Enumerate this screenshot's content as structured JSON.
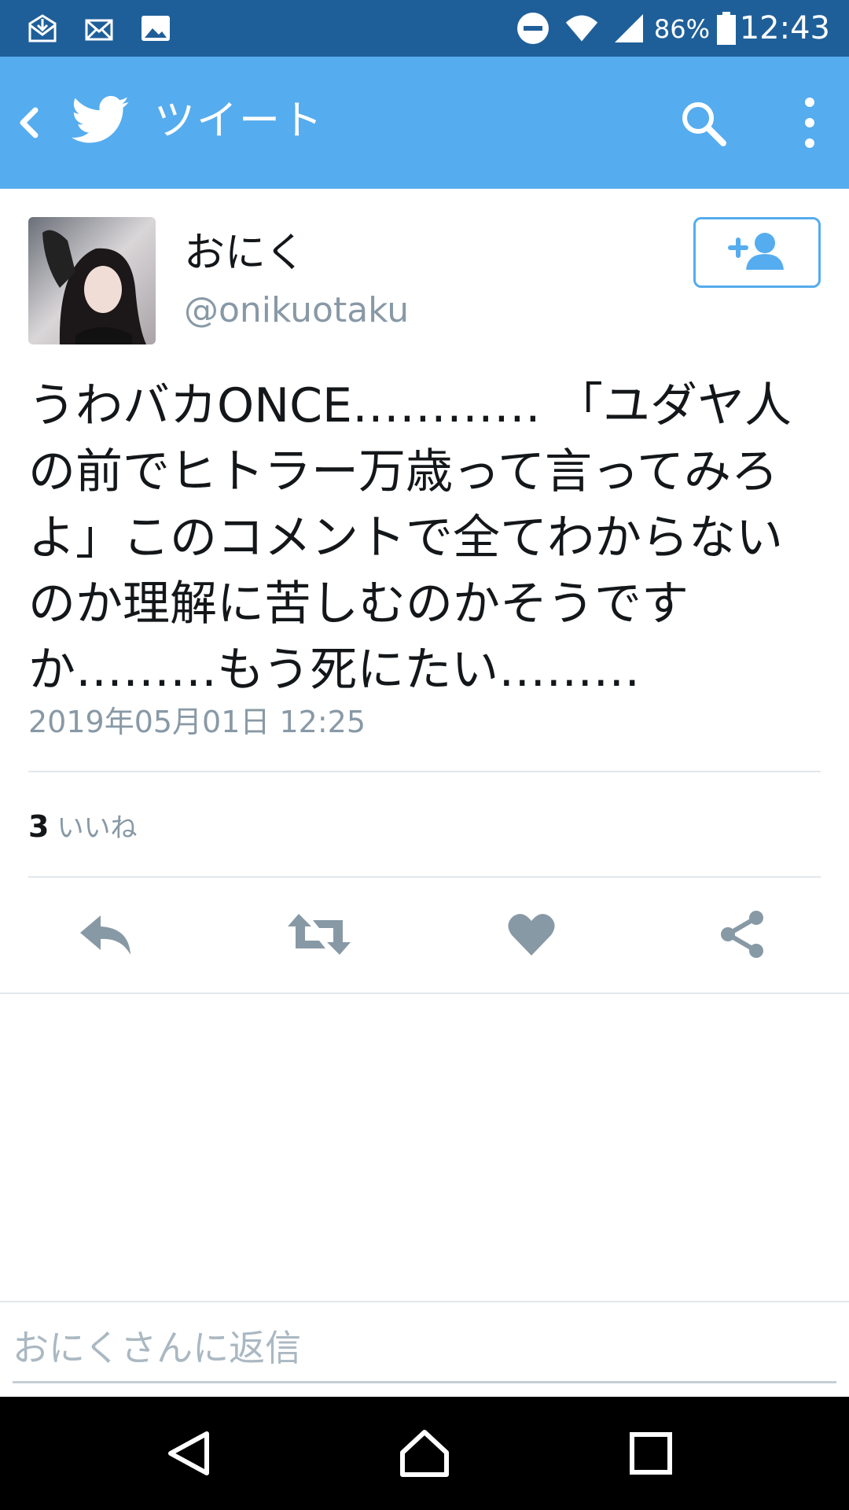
{
  "status_bar": {
    "battery_percent": "86%",
    "time": "12:43",
    "left_icons": [
      "download-mail-icon",
      "mail-icon",
      "image-icon"
    ],
    "right_icons": [
      "do-not-disturb-icon",
      "wifi-icon",
      "signal-icon",
      "battery-icon"
    ]
  },
  "app_bar": {
    "title": "ツイート",
    "back_icon": "chevron-left-icon",
    "logo_icon": "twitter-bird-icon",
    "search_icon": "search-icon",
    "menu_icon": "more-vertical-icon",
    "background": "#55acee"
  },
  "tweet": {
    "display_name": "おにく",
    "handle": "@onikuotaku",
    "text": "うわバカONCE………… 「ユダヤ人の前でヒトラー万歳って言ってみろよ」このコメントで全てわからないのか理解に苦しむのかそうですか………もう死にたい………",
    "timestamp": "2019年05月01日 12:25",
    "likes_count": "3",
    "likes_label": "いいね"
  },
  "actions": [
    "reply-icon",
    "retweet-icon",
    "like-icon",
    "share-icon"
  ],
  "reply": {
    "placeholder": "おにくさんに返信"
  },
  "nav_bar": [
    "back-triangle-icon",
    "home-icon",
    "recents-icon"
  ],
  "colors": {
    "status_bar": "#1f5f99",
    "accent": "#55acee",
    "secondary_text": "#8899a6",
    "action_icon": "#8899a6"
  }
}
